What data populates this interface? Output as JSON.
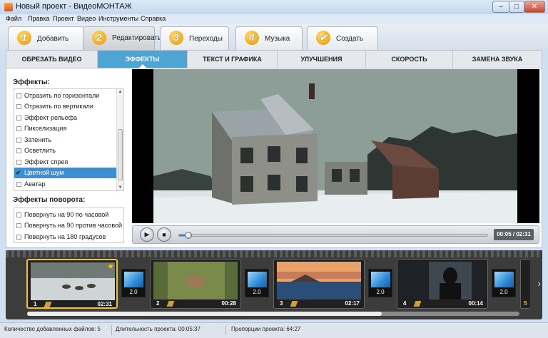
{
  "window": {
    "title": "Новый проект - ВидеоМОНТАЖ",
    "btn_min": "–",
    "btn_max": "□",
    "btn_close": "✕"
  },
  "menu": [
    "Файл",
    "Правка",
    "Проект",
    "Видео",
    "Инструменты",
    "Справка"
  ],
  "steps": [
    {
      "num": "1",
      "label": "Добавить"
    },
    {
      "num": "2",
      "label": "Редактировать",
      "active": true
    },
    {
      "num": "3",
      "label": "Переходы"
    },
    {
      "num": "4",
      "label": "Музыка"
    },
    {
      "num": "✔",
      "label": "Создать"
    }
  ],
  "subtabs": [
    "ОБРЕЗАТЬ ВИДЕО",
    "ЭФФЕКТЫ",
    "ТЕКСТ И ГРАФИКА",
    "УЛУЧШЕНИЯ",
    "СКОРОСТЬ",
    "ЗАМЕНА ЗВУКА"
  ],
  "subtabs_active": "ЭФФЕКТЫ",
  "effects": {
    "title": "Эффекты:",
    "items": [
      "Отразить по горизонтали",
      "Отразить по вертикали",
      "Эффект рельефа",
      "Пикселизация",
      "Затенить",
      "Осветлить",
      "Эффект спрея",
      "Цветной шум",
      "Аватар"
    ],
    "selected": "Цветной шум",
    "scroll_up": "▲",
    "scroll_down": "▼"
  },
  "rotation": {
    "title": "Эффекты поворота:",
    "items": [
      "Повернуть на 90 по часовой",
      "Повернуть на 90 против часовой",
      "Повернуть на 180 градусов"
    ]
  },
  "player": {
    "time": "00:05 / 02:31",
    "progress": 0.03,
    "play_icon": "▶",
    "stop_icon": "■"
  },
  "timeline": {
    "clips": [
      {
        "num": "1",
        "duration": "02:31",
        "selected": true
      },
      {
        "num": "2",
        "duration": "00:28"
      },
      {
        "num": "3",
        "duration": "02:17"
      },
      {
        "num": "4",
        "duration": "00:14"
      }
    ],
    "transitions": [
      "2.0",
      "2.0",
      "2.0",
      "2.0"
    ],
    "next_clip_num": "5",
    "star": "★",
    "next_arrow": "›",
    "scroll_visible_fraction": 0.72
  },
  "status": {
    "files": "Количество добавленных файлов: 5",
    "duration": "Длительность проекта:  00:05:37",
    "proportions": "Пропорции проекта:  64:27"
  }
}
